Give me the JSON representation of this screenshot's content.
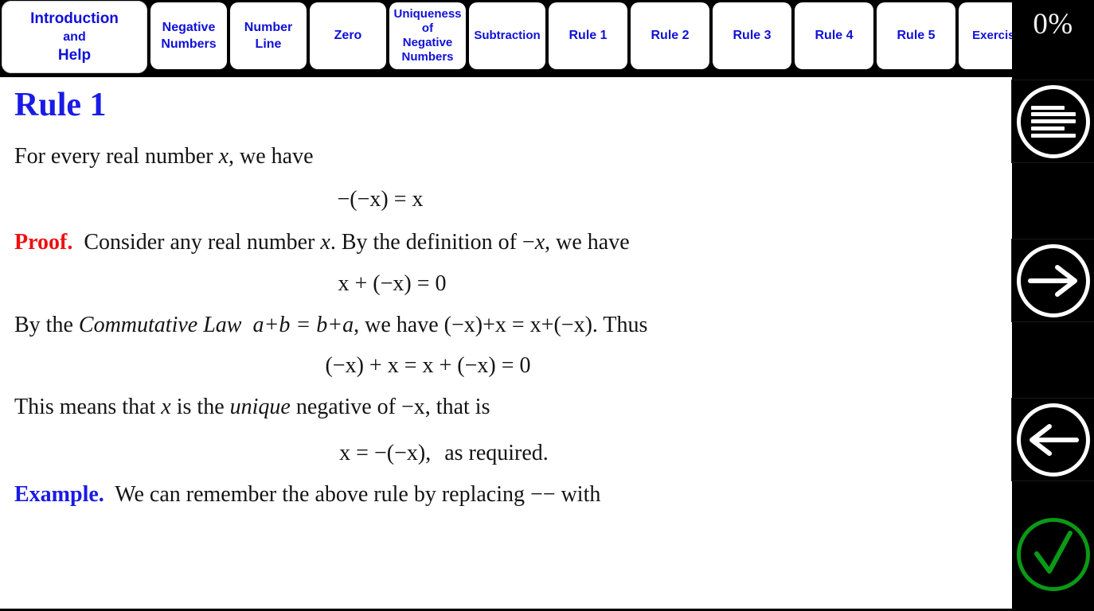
{
  "tabs": [
    {
      "name": "introduction-and-help",
      "lines": [
        "Introduction",
        "and",
        "Help"
      ]
    },
    {
      "name": "negative-numbers",
      "lines": [
        "Negative",
        "Numbers"
      ]
    },
    {
      "name": "number-line",
      "lines": [
        "Number",
        "Line"
      ]
    },
    {
      "name": "zero",
      "lines": [
        "Zero"
      ]
    },
    {
      "name": "uniqueness-of-negative-numbers",
      "lines": [
        "Uniqueness",
        "of",
        "Negative",
        "Numbers"
      ]
    },
    {
      "name": "subtraction",
      "lines": [
        "Subtraction"
      ]
    },
    {
      "name": "rule-1",
      "lines": [
        "Rule 1"
      ]
    },
    {
      "name": "rule-2",
      "lines": [
        "Rule 2"
      ]
    },
    {
      "name": "rule-3",
      "lines": [
        "Rule 3"
      ]
    },
    {
      "name": "rule-4",
      "lines": [
        "Rule 4"
      ]
    },
    {
      "name": "rule-5",
      "lines": [
        "Rule 5"
      ]
    },
    {
      "name": "exercise",
      "lines": [
        "Exercise"
      ]
    }
  ],
  "progress": {
    "percent_label": "0%"
  },
  "content": {
    "title": "Rule 1",
    "intro_before": "For every real number ",
    "intro_var": "x",
    "intro_after": ", we have",
    "equation_1": "−(−x)  =  x",
    "proof_label": "Proof.",
    "proof_text_1": "Consider any real number ",
    "proof_var_1": "x",
    "proof_text_2": ". By the definition of −",
    "proof_var_2": "x",
    "proof_text_3": ", we have",
    "equation_2": "x  +  (−x)  =  0",
    "law_before": "By the ",
    "law_name": "Commutative Law",
    "law_formula": "a+b = b+a",
    "law_after": ", we have (−x)+x = x+(−x). Thus",
    "equation_3": "(−x)  +  x  =  x  +  (−x)  =  0",
    "unique_before": "This means that ",
    "unique_var": "x",
    "unique_mid": " is the ",
    "unique_em": "unique",
    "unique_after": " negative of −x, that is",
    "equation_4": "x  =  −(−x),",
    "equation_4_note": "as required.",
    "example_label": "Example.",
    "example_text": "We can remember the above rule by replacing −− with"
  },
  "sidebar": {
    "menu_button": "menu-icon",
    "next_button": "arrow-right-icon",
    "prev_button": "arrow-left-icon",
    "check_button": "checkmark-icon"
  },
  "colors": {
    "tab_text": "#1010d8",
    "title": "#1a1ae6",
    "proof_keyword": "#ee1111",
    "example_keyword": "#1a1ae6",
    "check_green": "#0a9a16",
    "chrome": "#000000",
    "page": "#ffffff"
  }
}
